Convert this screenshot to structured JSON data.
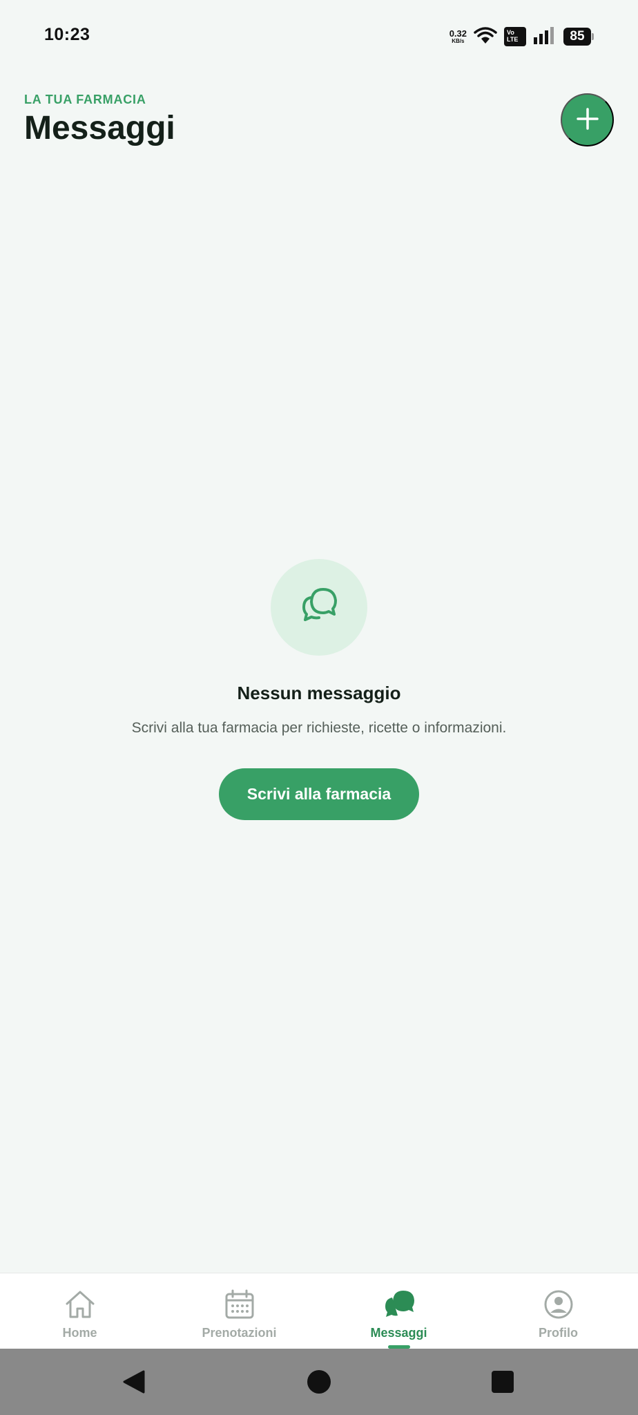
{
  "status_bar": {
    "time": "10:23",
    "net_speed_value": "0.32",
    "net_speed_unit": "KB/s",
    "volte_top": "Vo",
    "volte_bottom": "LTE",
    "battery": "85"
  },
  "header": {
    "subtitle": "LA TUA FARMACIA",
    "title": "Messaggi",
    "add_icon": "plus-icon"
  },
  "empty_state": {
    "icon": "chat-bubbles-icon",
    "title": "Nessun messaggio",
    "description": "Scrivi alla tua farmacia per richieste, ricette o informazioni.",
    "button_label": "Scrivi alla farmacia"
  },
  "bottom_nav": {
    "items": [
      {
        "label": "Home",
        "icon": "home-icon",
        "active": false
      },
      {
        "label": "Prenotazioni",
        "icon": "calendar-icon",
        "active": false
      },
      {
        "label": "Messaggi",
        "icon": "chat-icon",
        "active": true
      },
      {
        "label": "Profilo",
        "icon": "profile-icon",
        "active": false
      }
    ]
  },
  "colors": {
    "accent": "#38a066",
    "background": "#f3f7f5",
    "icon_circle": "#ddf1e4",
    "inactive": "#a3aaa6"
  }
}
